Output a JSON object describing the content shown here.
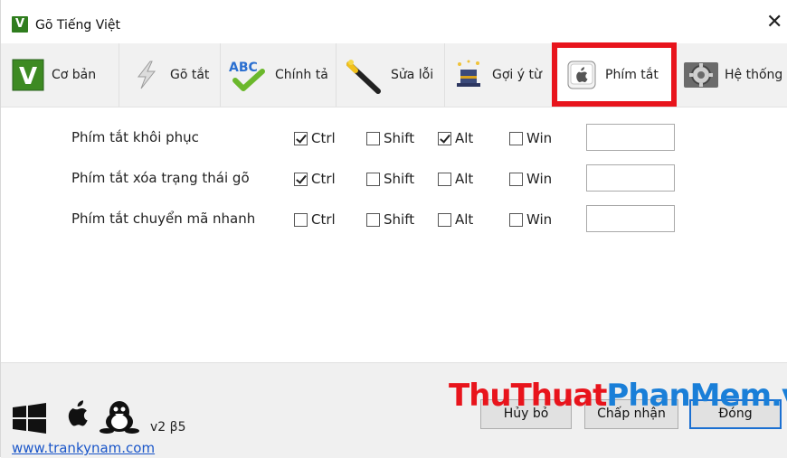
{
  "window": {
    "title": "Gõ Tiếng Việt",
    "app_icon_letter": "V",
    "close_glyph": "✕"
  },
  "tabs": [
    {
      "label": "Cơ bản",
      "icon": "v-logo-icon"
    },
    {
      "label": "Gõ tắt",
      "icon": "lightning-icon"
    },
    {
      "label": "Chính tả",
      "icon": "abc-check-icon"
    },
    {
      "label": "Sửa lỗi",
      "icon": "magic-wand-icon"
    },
    {
      "label": "Gợi ý từ",
      "icon": "wizard-hat-icon"
    },
    {
      "label": "Phím tắt",
      "icon": "apple-key-icon",
      "active": true
    },
    {
      "label": "Hệ thống",
      "icon": "gear-icon"
    }
  ],
  "shortcuts": {
    "modifiers": [
      "Ctrl",
      "Shift",
      "Alt",
      "Win"
    ],
    "rows": [
      {
        "label": "Phím tắt khôi phục",
        "ctrl": true,
        "shift": false,
        "alt": true,
        "win": false,
        "key": ""
      },
      {
        "label": "Phím tắt xóa trạng thái gõ",
        "ctrl": true,
        "shift": false,
        "alt": false,
        "win": false,
        "key": ""
      },
      {
        "label": "Phím tắt chuyển mã nhanh",
        "ctrl": false,
        "shift": false,
        "alt": false,
        "win": false,
        "key": ""
      }
    ]
  },
  "footer": {
    "version": "v2 β5",
    "link": "www.trankynam.com",
    "buttons": {
      "cancel": "Hủy bỏ",
      "accept": "Chấp nhận",
      "close": "Đóng"
    },
    "watermark": {
      "part1": "ThuThuat",
      "part2": "PhanMem.vn"
    }
  },
  "colors": {
    "highlight": "#e8141c",
    "link": "#1a56c9",
    "accent": "#1a6fd1"
  }
}
